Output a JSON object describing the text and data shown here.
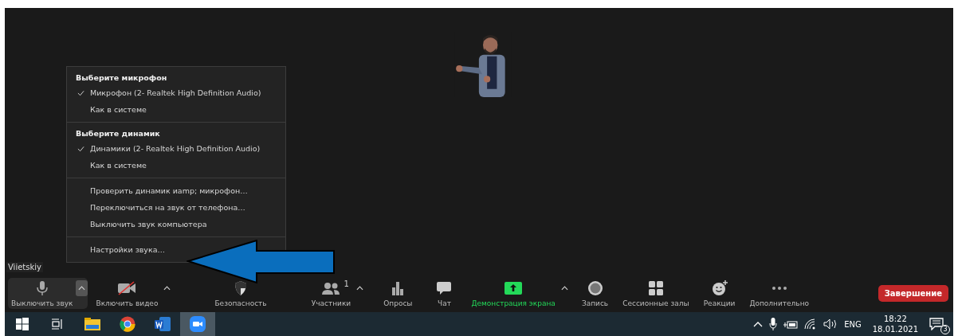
{
  "meeting": {
    "participant_name": "Viietskiy"
  },
  "audio_menu": {
    "sections": [
      {
        "kind": "choice",
        "heading": "Выберите микрофон",
        "items": [
          {
            "label": "Микрофон (2- Realtek High Definition Audio)",
            "checked": true
          },
          {
            "label": "Как в системе",
            "checked": false
          }
        ]
      },
      {
        "kind": "choice",
        "heading": "Выберите динамик",
        "items": [
          {
            "label": "Динамики (2- Realtek High Definition Audio)",
            "checked": true
          },
          {
            "label": "Как в системе",
            "checked": false
          }
        ]
      },
      {
        "kind": "actions",
        "items": [
          {
            "label": "Проверить динамик иamp; микрофон…"
          },
          {
            "label": "Переключиться на звук от телефона…"
          },
          {
            "label": "Выключить звук компьютера"
          }
        ]
      },
      {
        "kind": "actions",
        "items": [
          {
            "label": "Настройки звука…"
          }
        ]
      }
    ]
  },
  "toolbar": {
    "buttons": [
      {
        "kind": "mic",
        "label": "Выключить звук",
        "caret": {
          "expanded": true
        }
      },
      {
        "kind": "video",
        "label": "Включить видео",
        "caret": {
          "expanded": false
        }
      },
      {
        "kind": "security",
        "label": "Безопасность"
      },
      {
        "kind": "participants",
        "label": "Участники",
        "badge": "1",
        "caret": {
          "expanded": false
        }
      },
      {
        "kind": "polls",
        "label": "Опросы"
      },
      {
        "kind": "chat",
        "label": "Чат"
      },
      {
        "kind": "share",
        "label": "Демонстрация экрана",
        "caret": {
          "expanded": false
        }
      },
      {
        "kind": "record",
        "label": "Запись"
      },
      {
        "kind": "breakout",
        "label": "Сессионные залы"
      },
      {
        "kind": "reactions",
        "label": "Реакции"
      },
      {
        "kind": "more",
        "label": "Дополнительно"
      }
    ],
    "end_button": "Завершение"
  },
  "taskbar": {
    "apps": [
      {
        "kind": "start",
        "selected": false
      },
      {
        "kind": "taskview",
        "selected": false
      },
      {
        "kind": "explorer",
        "selected": false
      },
      {
        "kind": "chrome",
        "selected": false
      },
      {
        "kind": "word",
        "selected": false
      },
      {
        "kind": "zoom",
        "selected": true
      }
    ],
    "tray": {
      "language": "ENG",
      "time": "18:22",
      "date": "18.01.2021",
      "notifications": "3"
    }
  }
}
